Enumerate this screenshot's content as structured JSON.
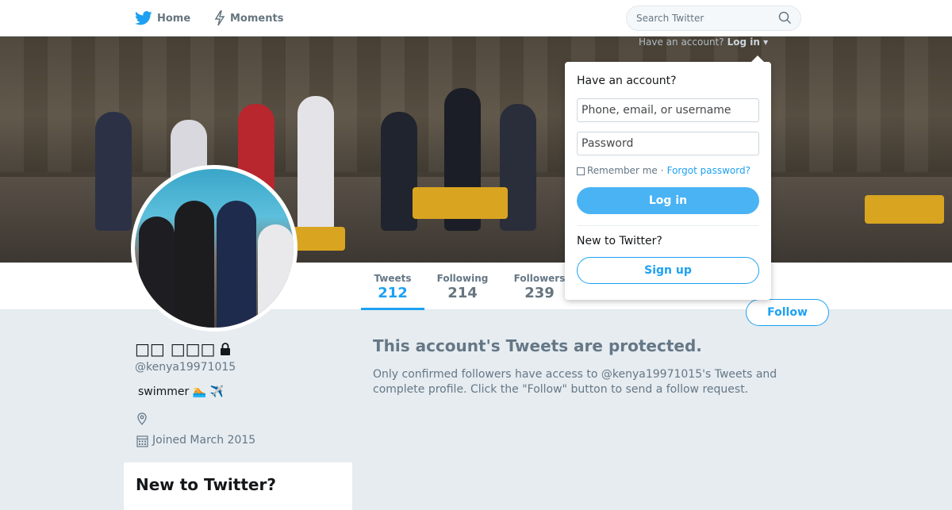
{
  "nav": {
    "home_label": "Home",
    "moments_label": "Moments",
    "search_placeholder": "Search Twitter"
  },
  "login_prompt": {
    "question": "Have an account?",
    "link": "Log in"
  },
  "login_dropdown": {
    "title": "Have an account?",
    "username_placeholder": "Phone, email, or username",
    "password_placeholder": "Password",
    "remember_label": "Remember me",
    "separator": "·",
    "forgot_label": "Forgot password?",
    "login_button": "Log in",
    "new_label": "New to Twitter?",
    "signup_button": "Sign up"
  },
  "stats": {
    "tweets_label": "Tweets",
    "tweets_value": "212",
    "following_label": "Following",
    "following_value": "214",
    "followers_label": "Followers",
    "followers_value": "239"
  },
  "follow_button": "Follow",
  "profile": {
    "name": "□□ □□□",
    "handle": "@kenya19971015",
    "bio": "swimmer 🏊 ✈️",
    "joined": "Joined March 2015"
  },
  "protected": {
    "title": "This account's Tweets are protected.",
    "text": "Only confirmed followers have access to @kenya19971015's Tweets and complete profile. Click the \"Follow\" button to send a follow request."
  },
  "side_card": {
    "title": "New to Twitter?"
  },
  "colors": {
    "accent": "#1da1f2",
    "login_button": "#4ab3f4",
    "background": "#e6ecf0"
  }
}
